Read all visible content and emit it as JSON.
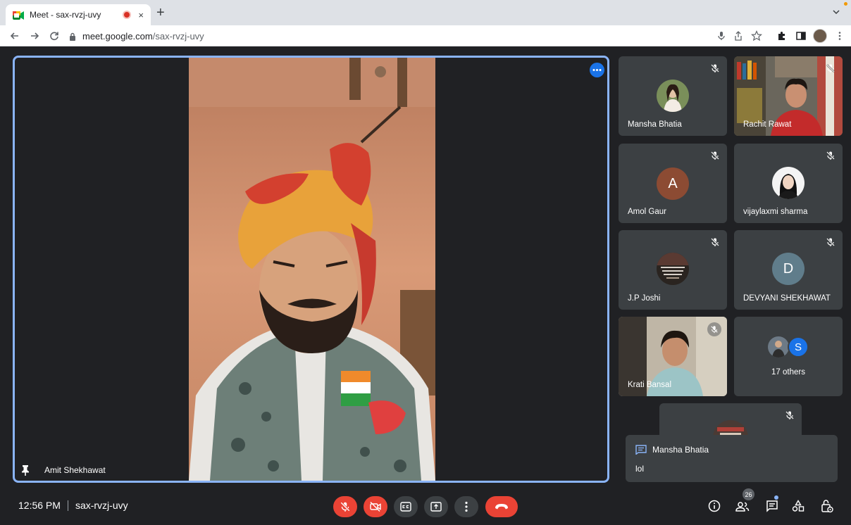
{
  "browser": {
    "tab_title": "Meet - sax-rvzj-uvy",
    "tab_close": "×",
    "new_tab": "+",
    "url_host": "meet.google.com",
    "url_path": "/sax-rvzj-uvy",
    "icons": [
      "back-icon",
      "forward-icon",
      "reload-icon",
      "lock-icon",
      "mic-icon",
      "share-icon",
      "star-icon",
      "extensions-icon",
      "sidepanel-icon",
      "profile-avatar",
      "menu-icon"
    ]
  },
  "stage": {
    "presenter_name": "Amit Shekhawat",
    "icons": [
      "pin-icon",
      "more-options-icon"
    ]
  },
  "participants": [
    {
      "name": "Mansha Bhatia",
      "type": "avatar-photo",
      "muted": true
    },
    {
      "name": "Rachit Rawat",
      "type": "video",
      "muted": true
    },
    {
      "name": "Amol Gaur",
      "type": "letter",
      "letter": "A",
      "color": "#8c4b33",
      "muted": true
    },
    {
      "name": "vijaylaxmi sharma",
      "type": "avatar-photo",
      "muted": true
    },
    {
      "name": "J.P Joshi",
      "type": "avatar-photo",
      "muted": true
    },
    {
      "name": "DEVYANI SHEKHAWAT",
      "type": "letter",
      "letter": "D",
      "color": "#607d8b",
      "muted": true
    },
    {
      "name": "Krati Bansal",
      "type": "video",
      "muted": true
    }
  ],
  "others_tile": {
    "label": "17 others",
    "letter": "S",
    "color": "#1a73e8"
  },
  "chat_toast": {
    "sender": "Mansha Bhatia",
    "message": "lol"
  },
  "bottom_bar": {
    "time": "12:56 PM",
    "meeting_code": "sax-rvzj-uvy",
    "participant_count": "26",
    "controls": [
      "mic-off-icon",
      "camera-off-icon",
      "captions-icon",
      "present-icon",
      "more-icon",
      "end-call-icon"
    ],
    "right_controls": [
      "info-icon",
      "people-icon",
      "chat-icon",
      "activities-icon",
      "host-controls-icon"
    ]
  },
  "colors": {
    "accent": "#8ab4f8",
    "danger": "#ea4335",
    "tile_bg": "#3c4043",
    "page_bg": "#202124"
  }
}
